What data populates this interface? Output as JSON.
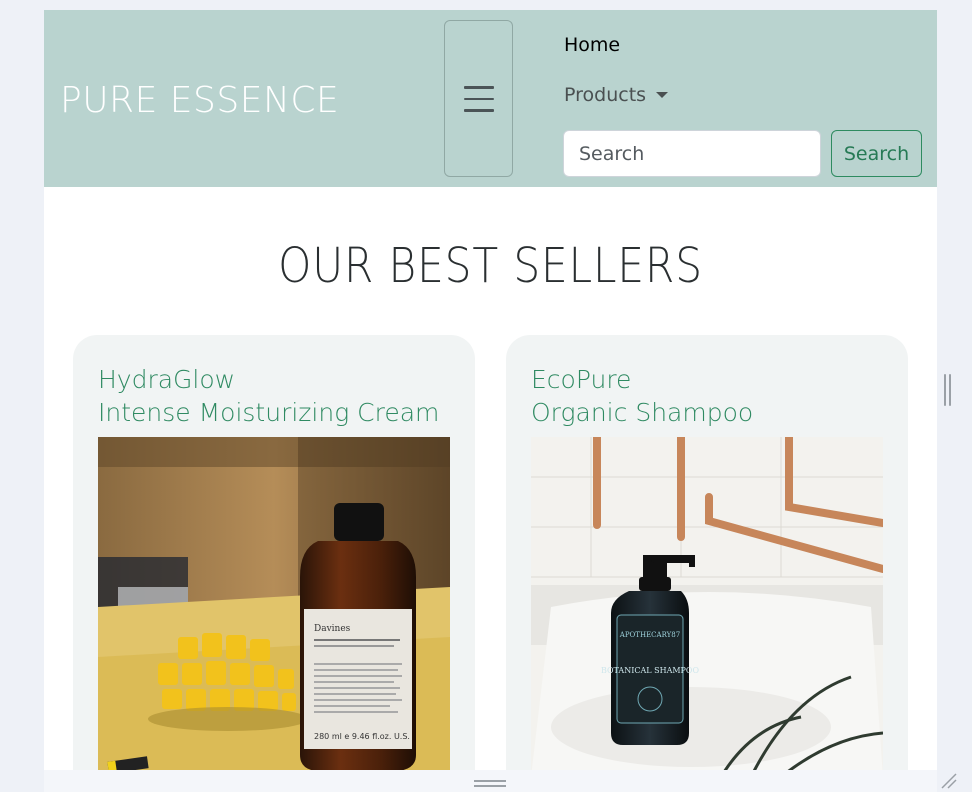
{
  "navbar": {
    "brand": "PURE ESSENCE",
    "links": [
      {
        "label": "Home"
      },
      {
        "label": "Products"
      }
    ],
    "search": {
      "placeholder": "Search",
      "value": "",
      "button_label": "Search"
    }
  },
  "main": {
    "title": "OUR BEST SELLERS",
    "products": [
      {
        "name": "HydraGlow",
        "subtitle": "Intense Moisturizing Cream",
        "image_label": "Davines",
        "image_text": "280 ml e 9.46 fl.oz. U.S."
      },
      {
        "name": "EcoPure",
        "subtitle": "Organic Shampoo",
        "image_label": "APOTHECARY87",
        "image_text": "BOTANICAL SHAMPOO"
      }
    ]
  }
}
